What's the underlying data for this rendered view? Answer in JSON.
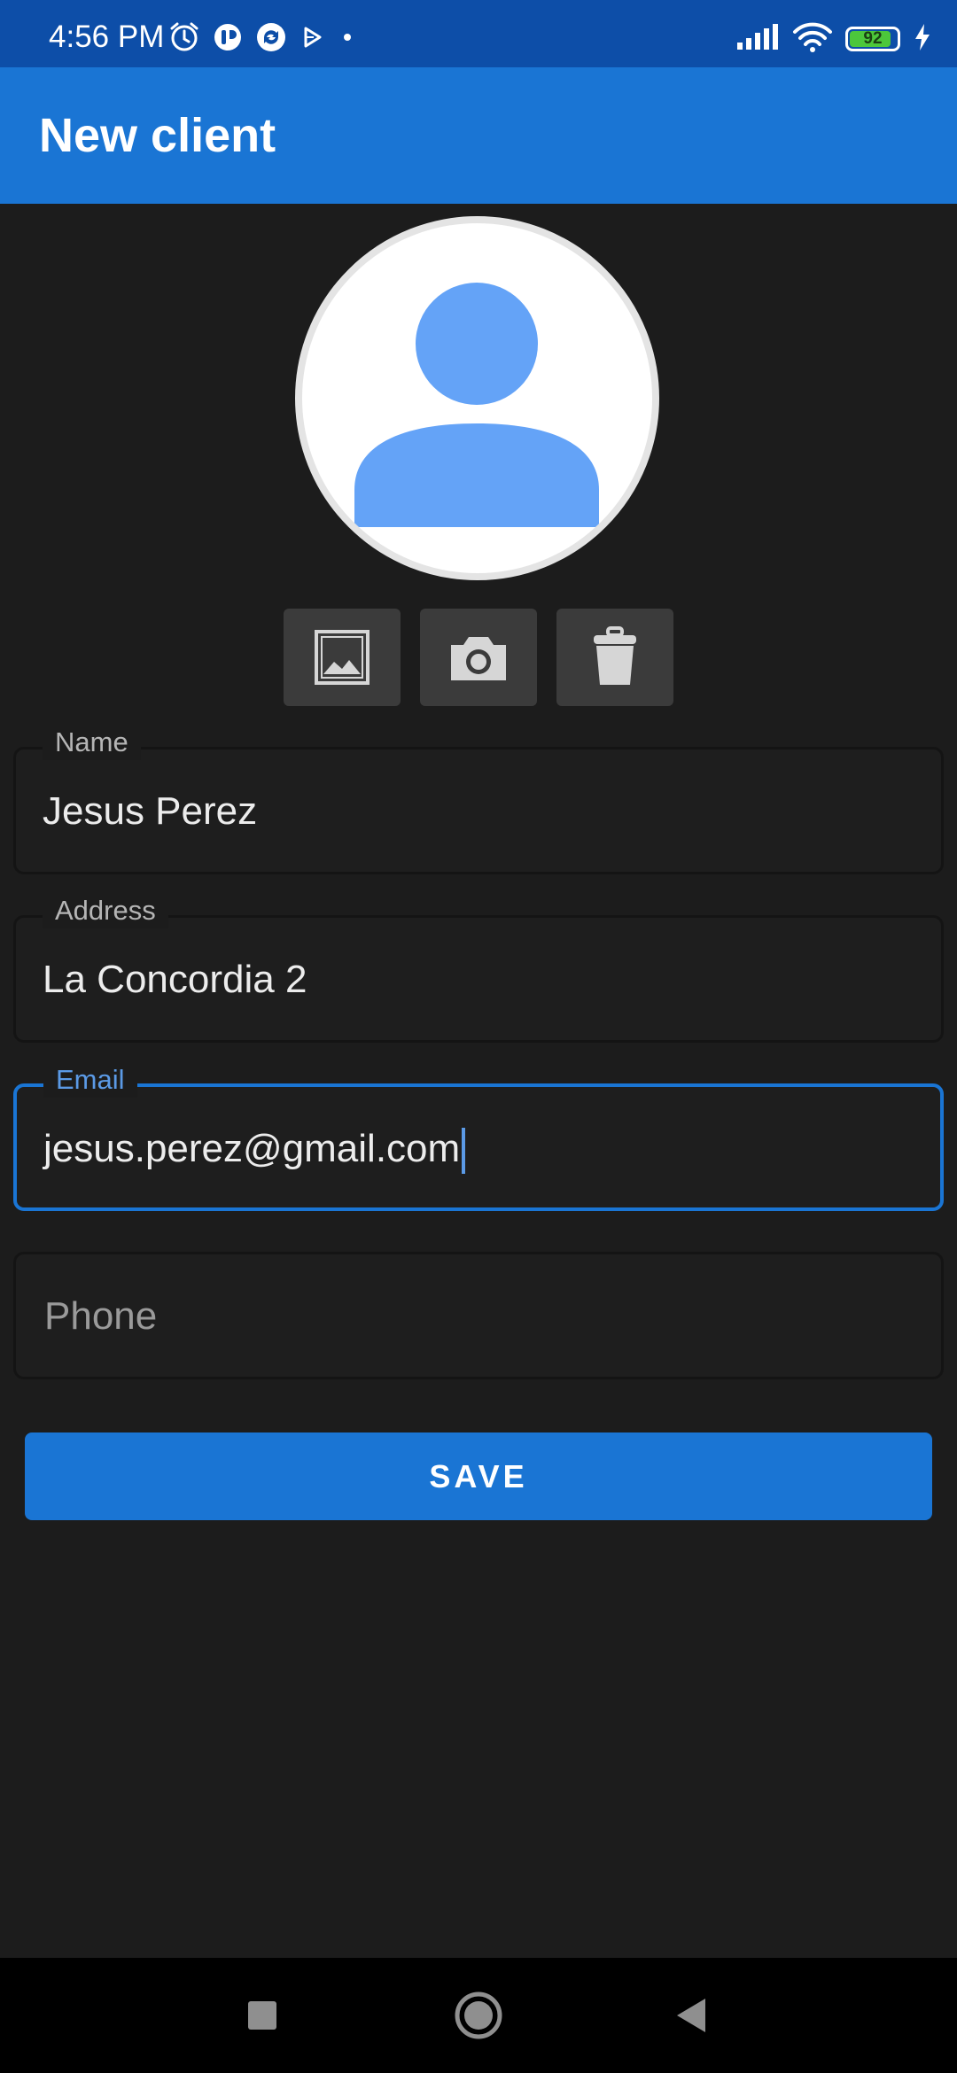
{
  "status_bar": {
    "time": "4:56 PM",
    "battery_level": "92",
    "icons_left": [
      "alarm-icon",
      "app-notification-icon",
      "sync-app-icon",
      "play-store-icon",
      "dot-icon"
    ],
    "icons_right": [
      "signal-icon",
      "wifi-icon",
      "battery-icon",
      "charging-icon"
    ],
    "battery_color": "#4cc73b"
  },
  "app_bar": {
    "title": "New client",
    "color": "#1a75d4"
  },
  "avatar": {
    "icon": "person-placeholder-icon",
    "color": "#64a3f7"
  },
  "photo_actions": [
    {
      "name": "gallery-button",
      "icon": "image-icon"
    },
    {
      "name": "camera-button",
      "icon": "camera-icon"
    },
    {
      "name": "delete-photo-button",
      "icon": "trash-icon"
    }
  ],
  "form": {
    "name": {
      "label": "Name",
      "value": "Jesus Perez"
    },
    "address": {
      "label": "Address",
      "value": "La Concordia 2"
    },
    "email": {
      "label": "Email",
      "value": "jesus.perez@gmail.com"
    },
    "phone": {
      "placeholder": "Phone",
      "value": ""
    }
  },
  "save_button": {
    "label": "SAVE"
  },
  "nav_bar": {
    "buttons": [
      "recents-icon",
      "home-icon",
      "back-icon"
    ]
  }
}
